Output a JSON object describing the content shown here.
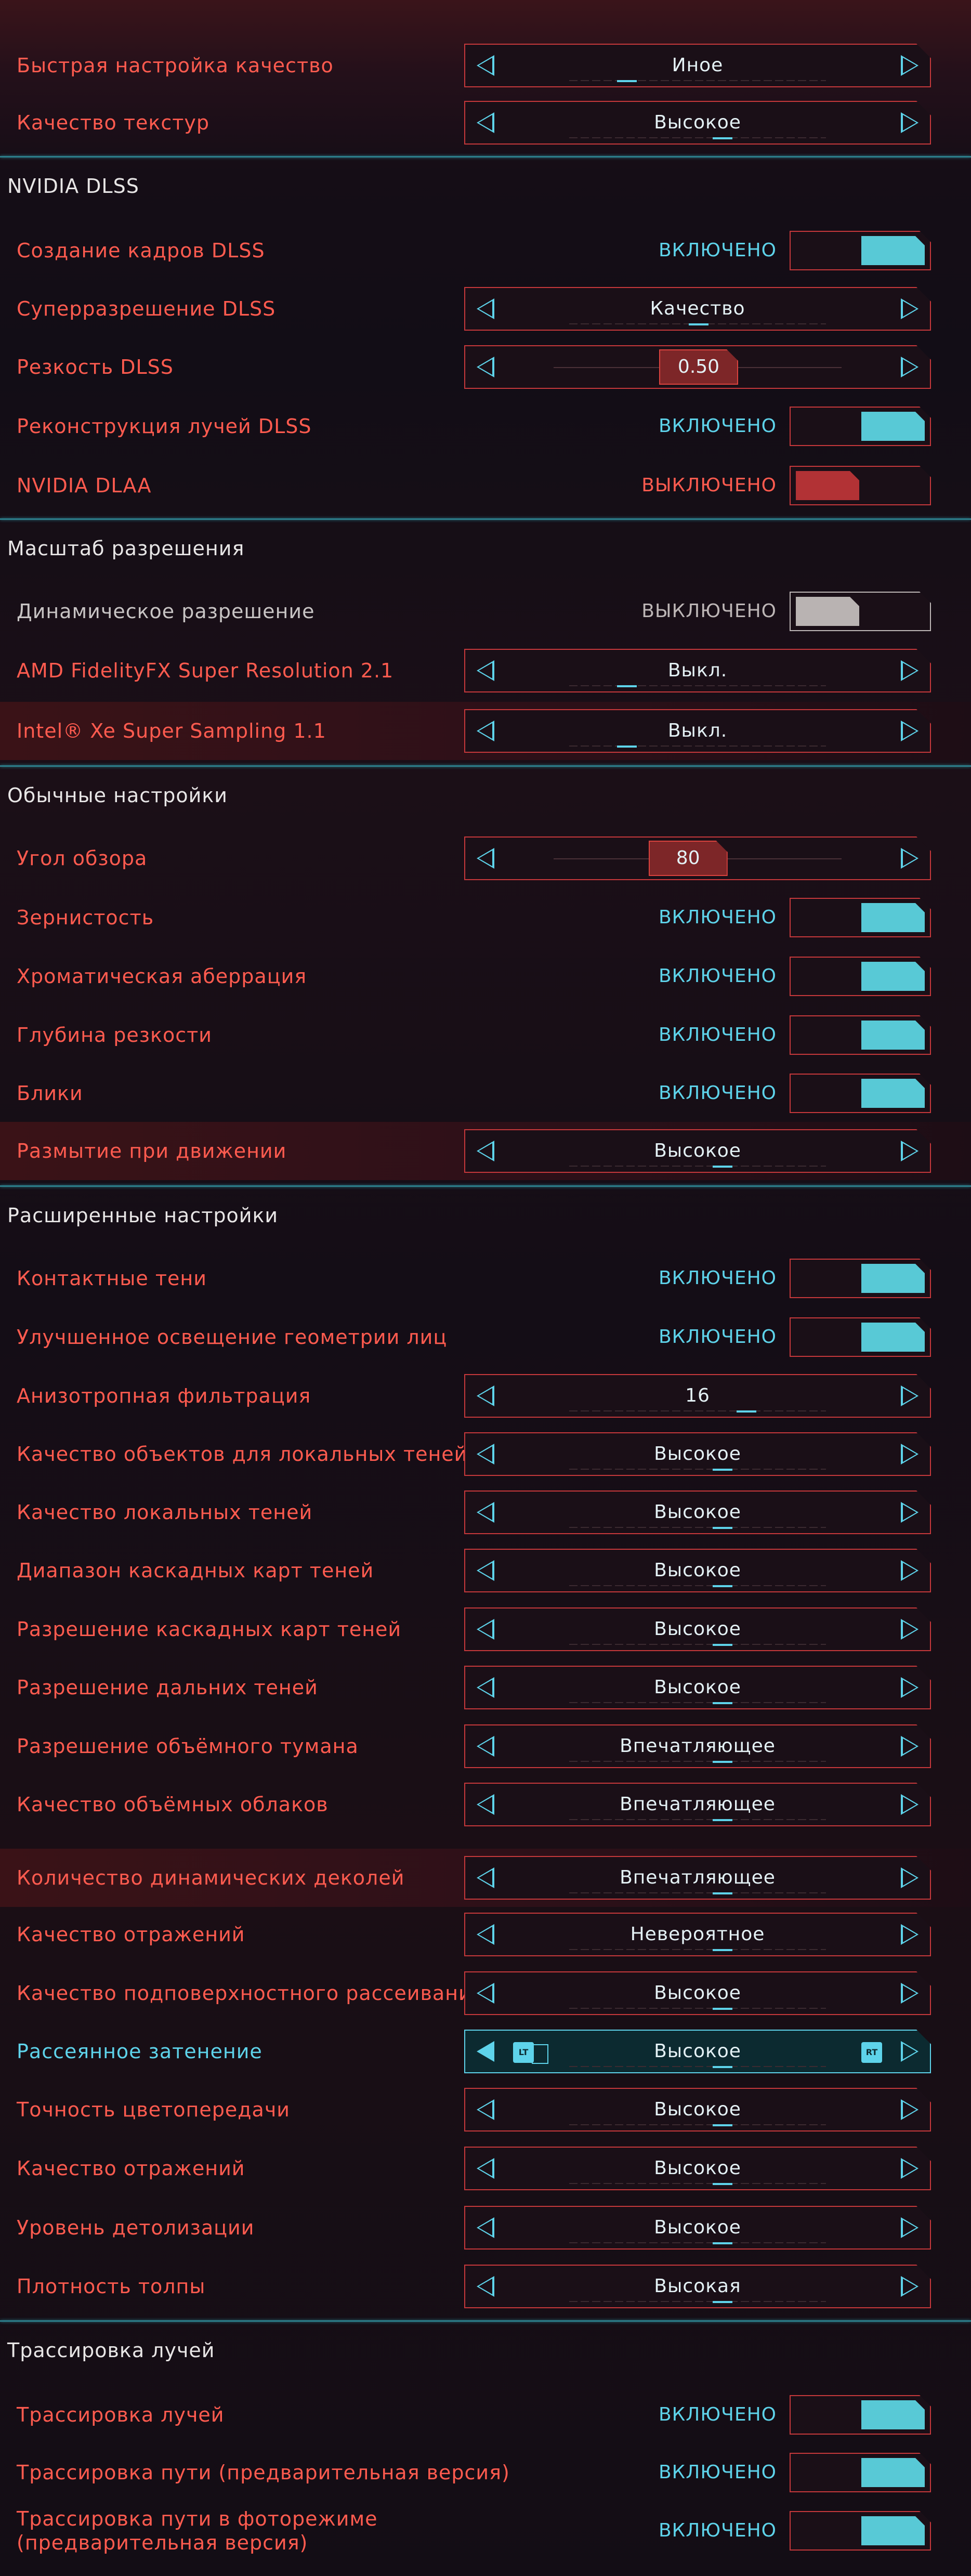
{
  "colors": {
    "accent": "#5ed3ea",
    "label": "#ff5b4f",
    "border": "#c5383b",
    "off_knob": "#b23235",
    "section_line": "#2c7d8a"
  },
  "rows": [
    {
      "kind": "selector",
      "label": "Быстрая настройка качество",
      "value": "Иное",
      "ind": 0.2
    },
    {
      "kind": "selector",
      "label": "Качество текстур",
      "value": "Высокое",
      "ind": 0.6
    },
    {
      "kind": "section",
      "title": "NVIDIA DLSS"
    },
    {
      "kind": "toggle",
      "label": "Создание кадров DLSS",
      "state_text": "ВКЛЮЧЕНО",
      "state": "on"
    },
    {
      "kind": "selector",
      "label": "Суперразрешение DLSS",
      "value": "Качество",
      "ind": 0.5
    },
    {
      "kind": "slider",
      "label": "Резкость DLSS",
      "value": "0.50",
      "pos": 0.5
    },
    {
      "kind": "toggle",
      "label": "Реконструкция лучей DLSS",
      "state_text": "ВКЛЮЧЕНО",
      "state": "on"
    },
    {
      "kind": "toggle",
      "label": "NVIDIA DLAA",
      "state_text": "ВЫКЛЮЧЕНО",
      "state": "off"
    },
    {
      "kind": "section",
      "title": "Масштаб разрешения"
    },
    {
      "kind": "toggle",
      "label": "Динамическое разрешение",
      "state_text": "ВЫКЛЮЧЕНО",
      "state": "grey",
      "dim": true
    },
    {
      "kind": "selector",
      "label": "AMD FidelityFX Super Resolution 2.1",
      "value": "Выкл.",
      "ind": 0.2
    },
    {
      "kind": "selector",
      "label": "Intel® Xe Super Sampling 1.1",
      "value": "Выкл.",
      "ind": 0.2,
      "highlight": true
    },
    {
      "kind": "section",
      "title": "Обычные настройки"
    },
    {
      "kind": "slider",
      "label": "Угол обзора",
      "value": "80",
      "pos": 0.45
    },
    {
      "kind": "toggle",
      "label": "Зернистость",
      "state_text": "ВКЛЮЧЕНО",
      "state": "on"
    },
    {
      "kind": "toggle",
      "label": "Хроматическая аберрация",
      "state_text": "ВКЛЮЧЕНО",
      "state": "on"
    },
    {
      "kind": "toggle",
      "label": "Глубина резкости",
      "state_text": "ВКЛЮЧЕНО",
      "state": "on"
    },
    {
      "kind": "toggle",
      "label": "Блики",
      "state_text": "ВКЛЮЧЕНО",
      "state": "on"
    },
    {
      "kind": "selector",
      "label": "Размытие при движении",
      "value": "Высокое",
      "ind": 0.6,
      "highlight": true
    },
    {
      "kind": "section",
      "title": "Расширенные настройки"
    },
    {
      "kind": "toggle",
      "label": "Контактные тени",
      "state_text": "ВКЛЮЧЕНО",
      "state": "on"
    },
    {
      "kind": "toggle",
      "label": "Улучшенное освещение геометрии лиц",
      "state_text": "ВКЛЮЧЕНО",
      "state": "on"
    },
    {
      "kind": "selector",
      "label": "Анизотропная фильтрация",
      "value": "16",
      "ind": 0.7
    },
    {
      "kind": "selector",
      "label": "Качество объектов для локальных теней",
      "value": "Высокое",
      "ind": 0.6
    },
    {
      "kind": "selector",
      "label": "Качество локальных теней",
      "value": "Высокое",
      "ind": 0.6
    },
    {
      "kind": "selector",
      "label": "Диапазон каскадных карт теней",
      "value": "Высокое",
      "ind": 0.6
    },
    {
      "kind": "selector",
      "label": "Разрешение каскадных карт теней",
      "value": "Высокое",
      "ind": 0.6
    },
    {
      "kind": "selector",
      "label": "Разрешение дальних теней",
      "value": "Высокое",
      "ind": 0.6
    },
    {
      "kind": "selector",
      "label": "Разрешение объёмного тумана",
      "value": "Впечатляющее",
      "ind": 0.6
    },
    {
      "kind": "selector",
      "label": "Качество объёмных облаков",
      "value": "Впечатляющее",
      "ind": 0.6
    },
    {
      "kind": "selector",
      "label": "Количество динамических деколей",
      "value": "Впечатляющее",
      "ind": 0.6,
      "highlight": true
    },
    {
      "kind": "selector",
      "label": "Качество отражений",
      "value": "Невероятное",
      "ind": 0.6
    },
    {
      "kind": "selector",
      "label": "Качество подповерхностного рассеивания",
      "value": "Высокое",
      "ind": 0.6
    },
    {
      "kind": "selector",
      "label": "Рассеянное затенение",
      "value": "Высокое",
      "ind": 0.6,
      "active": true,
      "hint_left": "LT",
      "hint_right": "RT"
    },
    {
      "kind": "selector",
      "label": "Точность цветопередачи",
      "value": "Высокое",
      "ind": 0.6
    },
    {
      "kind": "selector",
      "label": "Качество отражений",
      "value": "Высокое",
      "ind": 0.6
    },
    {
      "kind": "selector",
      "label": "Уровень детолизации",
      "value": "Высокое",
      "ind": 0.6
    },
    {
      "kind": "selector",
      "label": "Плотность толпы",
      "value": "Высокая",
      "ind": 0.6
    },
    {
      "kind": "section",
      "title": "Трассировка лучей"
    },
    {
      "kind": "toggle",
      "label": "Трассировка лучей",
      "state_text": "ВКЛЮЧЕНО",
      "state": "on"
    },
    {
      "kind": "toggle",
      "label": "Трассировка пути (предварительная версия)",
      "state_text": "ВКЛЮЧЕНО",
      "state": "on"
    },
    {
      "kind": "toggle",
      "label": "Трассировка пути в фоторежиме (предварительная версия)",
      "state_text": "ВКЛЮЧЕНО",
      "state": "on",
      "two_line": true
    }
  ]
}
